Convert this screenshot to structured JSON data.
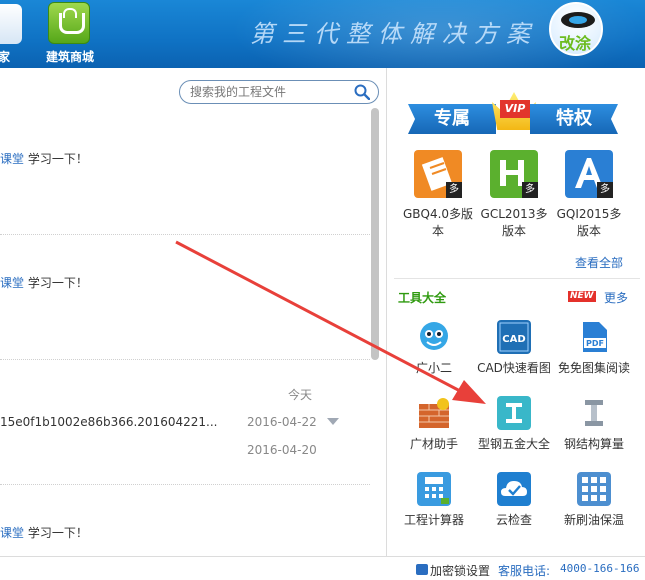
{
  "header": {
    "home_label": "家",
    "mall_label": "建筑商城",
    "slogan": "第三代整体解决方案",
    "logo_text": "改涂"
  },
  "main": {
    "search_placeholder": "搜索我的工程文件",
    "feed": [
      {
        "link": "课堂",
        "text": " 学习一下！"
      },
      {
        "link": "课堂",
        "text": " 学习一下！"
      },
      {
        "link": "课堂",
        "text": " 学习一下！"
      }
    ],
    "today_label": "今天",
    "file_name": "15e0f1b1002e86b366.201604221...",
    "dates": [
      "2016-04-22",
      "2016-04-20"
    ]
  },
  "sidebar": {
    "vip_left": "专属",
    "vip_badge": "VIP",
    "vip_right": "特权",
    "vip_apps": [
      {
        "label": "GBQ4.0多版本",
        "color": "#f08a24",
        "duo": "多"
      },
      {
        "label": "GCL2013多版本",
        "color": "#5bb02e",
        "duo": "多"
      },
      {
        "label": "GQI2015多版本",
        "color": "#2a7fd4",
        "duo": "多"
      }
    ],
    "view_all": "查看全部",
    "tools_title": "工具大全",
    "new_badge": "NEW",
    "more": "更多",
    "tools": [
      {
        "label": "广小二",
        "icon": "mascot-icon"
      },
      {
        "label": "CAD快速看图",
        "icon": "cad-icon"
      },
      {
        "label": "免免图集阅读",
        "icon": "pdf-icon"
      },
      {
        "label": "广材助手",
        "icon": "materials-icon"
      },
      {
        "label": "型钢五金大全",
        "icon": "steel-icon"
      },
      {
        "label": "钢结构算量",
        "icon": "steel-structure-icon"
      },
      {
        "label": "工程计算器",
        "icon": "calculator-icon"
      },
      {
        "label": "云检查",
        "icon": "cloud-check-icon"
      },
      {
        "label": "新刷油保温",
        "icon": "paint-insulation-icon"
      }
    ]
  },
  "footer": {
    "lock_label": "加密锁设置",
    "phone_label": "客服电话:",
    "phone_number": "4000-166-166"
  },
  "colors": {
    "header_blue": "#1378c8",
    "link_blue": "#2a6dc0",
    "tools_green": "#2f9a0f",
    "arrow_red": "#e8403a"
  }
}
